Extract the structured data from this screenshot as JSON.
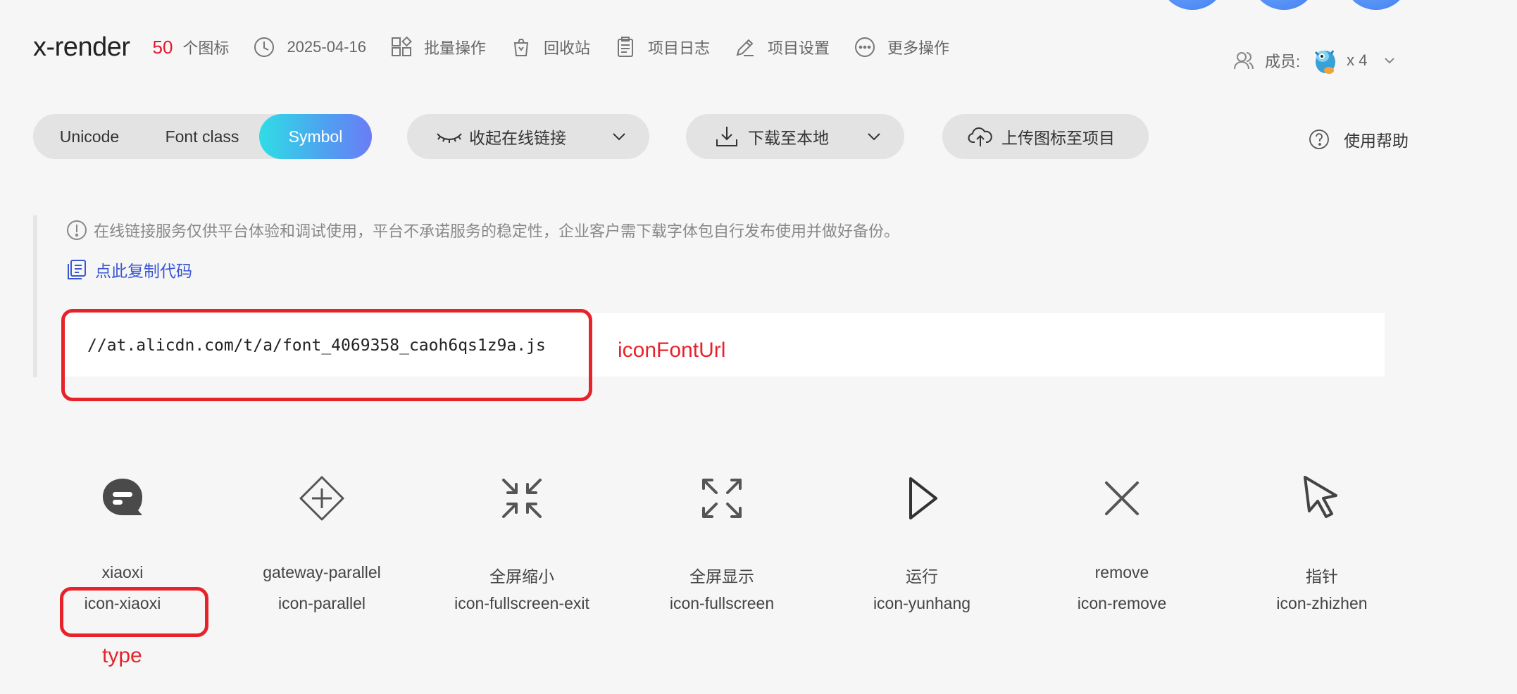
{
  "project": {
    "title": "x-render",
    "icon_count": "50",
    "icon_count_label": "个图标",
    "date": "2025-04-16"
  },
  "header_actions": [
    {
      "label": "批量操作",
      "icon": "batch-icon"
    },
    {
      "label": "回收站",
      "icon": "recycle-bin-icon"
    },
    {
      "label": "项目日志",
      "icon": "clipboard-icon"
    },
    {
      "label": "项目设置",
      "icon": "edit-icon"
    },
    {
      "label": "更多操作",
      "icon": "more-icon"
    }
  ],
  "members": {
    "label": "成员:",
    "count": "x 4"
  },
  "tabs": [
    {
      "label": "Unicode",
      "active": false
    },
    {
      "label": "Font class",
      "active": false
    },
    {
      "label": "Symbol",
      "active": true
    }
  ],
  "toolbar": {
    "online_link": "收起在线链接",
    "download": "下载至本地",
    "upload": "上传图标至项目",
    "help": "使用帮助"
  },
  "notice": {
    "text": "在线链接服务仅供平台体验和调试使用，平台不承诺服务的稳定性，企业客户需下载字体包自行发布使用并做好备份。",
    "copy_code": "点此复制代码",
    "url": "//at.alicdn.com/t/a/font_4069358_caoh6qs1z9a.js"
  },
  "annotations": {
    "font_url": "iconFontUrl",
    "type": "type"
  },
  "icons": [
    {
      "name": "xiaoxi",
      "code": "icon-xiaoxi",
      "icon": "message-icon"
    },
    {
      "name": "gateway-parallel",
      "code": "icon-parallel",
      "icon": "parallel-gateway-icon"
    },
    {
      "name": "全屏缩小",
      "code": "icon-fullscreen-exit",
      "icon": "fullscreen-exit-icon"
    },
    {
      "name": "全屏显示",
      "code": "icon-fullscreen",
      "icon": "fullscreen-icon"
    },
    {
      "name": "运行",
      "code": "icon-yunhang",
      "icon": "play-icon"
    },
    {
      "name": "remove",
      "code": "icon-remove",
      "icon": "close-icon"
    },
    {
      "name": "指针",
      "code": "icon-zhizhen",
      "icon": "pointer-icon"
    }
  ],
  "colors": {
    "accent_red": "#e6162d",
    "link_blue": "#3a56d4",
    "symbol_gradient_start": "#2fdde6",
    "symbol_gradient_end": "#6b7cf6",
    "annotation_red": "#e8222b"
  }
}
